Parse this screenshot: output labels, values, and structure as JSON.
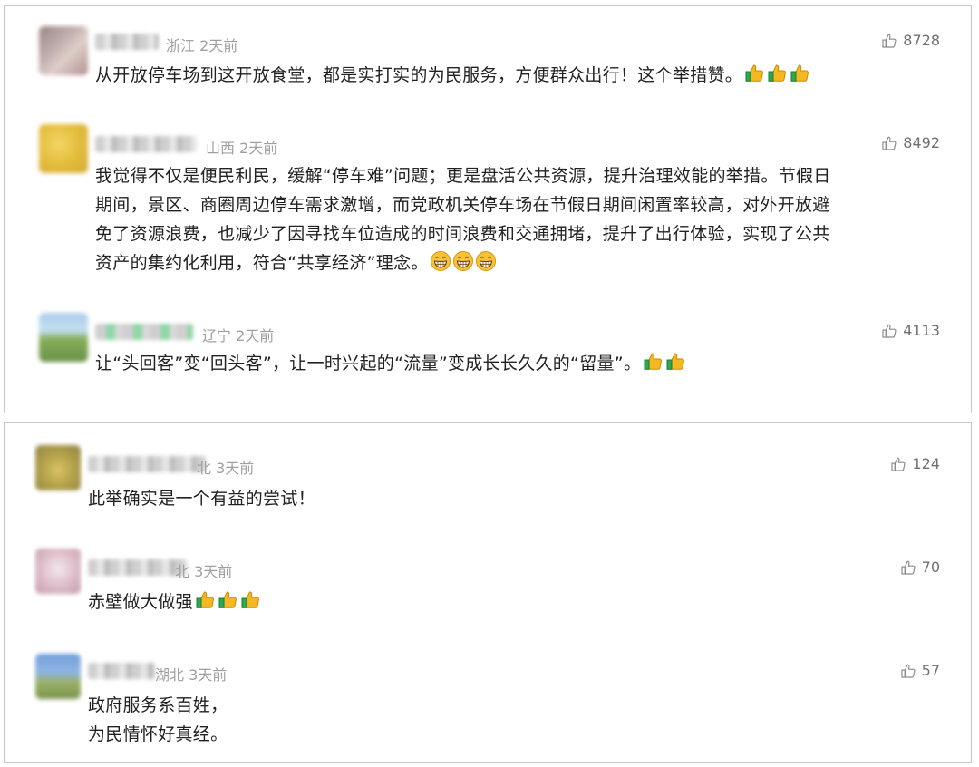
{
  "panel_top": {
    "comments": [
      {
        "location": "浙江",
        "time": "2天前",
        "likes": "8728",
        "text": "从开放停车场到这开放食堂，都是实打实的为民服务，方便群众出行！这个举措赞。",
        "emojis": [
          "thumbs-up",
          "thumbs-up",
          "thumbs-up"
        ]
      },
      {
        "location": "山西",
        "time": "2天前",
        "likes": "8492",
        "lines": [
          "我觉得不仅是便民利民，缓解“停车难”问题；更是盘活公共资源，提升治理效能的举措。节假日",
          "期间，景区、商圈周边停车需求激增，而党政机关停车场在节假日期间闲置率较高，对外开放避",
          "免了资源浪费，也减少了因寻找车位造成的时间浪费和交通拥堵，提升了出行体验，实现了公共",
          "资产的集约化利用，符合“共享经济”理念。"
        ],
        "emojis": [
          "grin",
          "grin",
          "grin"
        ]
      },
      {
        "location": "辽宁",
        "time": "2天前",
        "likes": "4113",
        "text": "让“头回客”变“回头客”，让一时兴起的“流量”变成长长久久的“留量”。",
        "emojis": [
          "thumbs-up",
          "thumbs-up"
        ]
      }
    ]
  },
  "panel_bottom": {
    "comments": [
      {
        "location": "北",
        "time": "3天前",
        "likes": "124",
        "text": "此举确实是一个有益的尝试！"
      },
      {
        "location": "北",
        "time": "3天前",
        "likes": "70",
        "text": "赤壁做大做强",
        "emojis": [
          "thumbs-up",
          "thumbs-up",
          "thumbs-up"
        ]
      },
      {
        "location": "湖北",
        "time": "3天前",
        "likes": "57",
        "lines": [
          "政府服务系百姓，",
          "为民情怀好真经。"
        ]
      }
    ]
  },
  "colors": {
    "border": "#c9c9c9",
    "meta": "#a0a0a0",
    "text": "#222222",
    "thumb_yellow": "#f5b820",
    "thumb_green": "#2fa84f"
  }
}
